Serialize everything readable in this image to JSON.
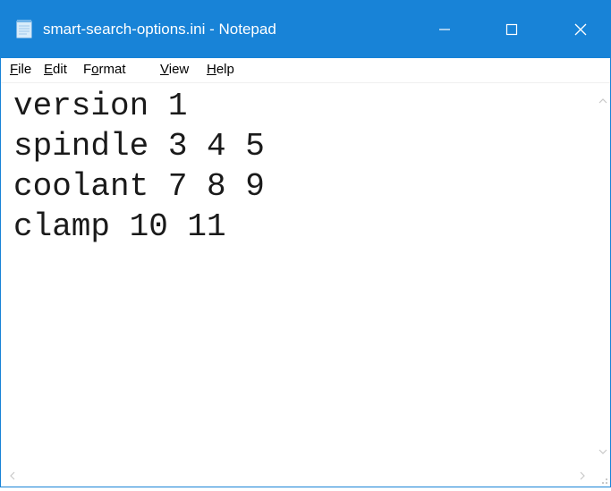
{
  "window": {
    "title": "smart-search-options.ini - Notepad",
    "accent_color": "#1883d7",
    "icons": {
      "app": "notepad-icon",
      "minimize": "minimize-icon",
      "maximize": "maximize-icon",
      "close": "close-icon"
    }
  },
  "menu": {
    "file": {
      "mnemonic": "F",
      "rest": "ile"
    },
    "edit": {
      "mnemonic": "E",
      "rest": "dit"
    },
    "format": {
      "pre": "F",
      "mnemonic": "o",
      "rest": "rmat"
    },
    "view": {
      "mnemonic": "V",
      "rest": "iew"
    },
    "help": {
      "mnemonic": "H",
      "rest": "elp"
    }
  },
  "editor": {
    "lines": [
      "version 1",
      "spindle 3 4 5",
      "coolant 7 8 9",
      "clamp 10 11"
    ]
  }
}
